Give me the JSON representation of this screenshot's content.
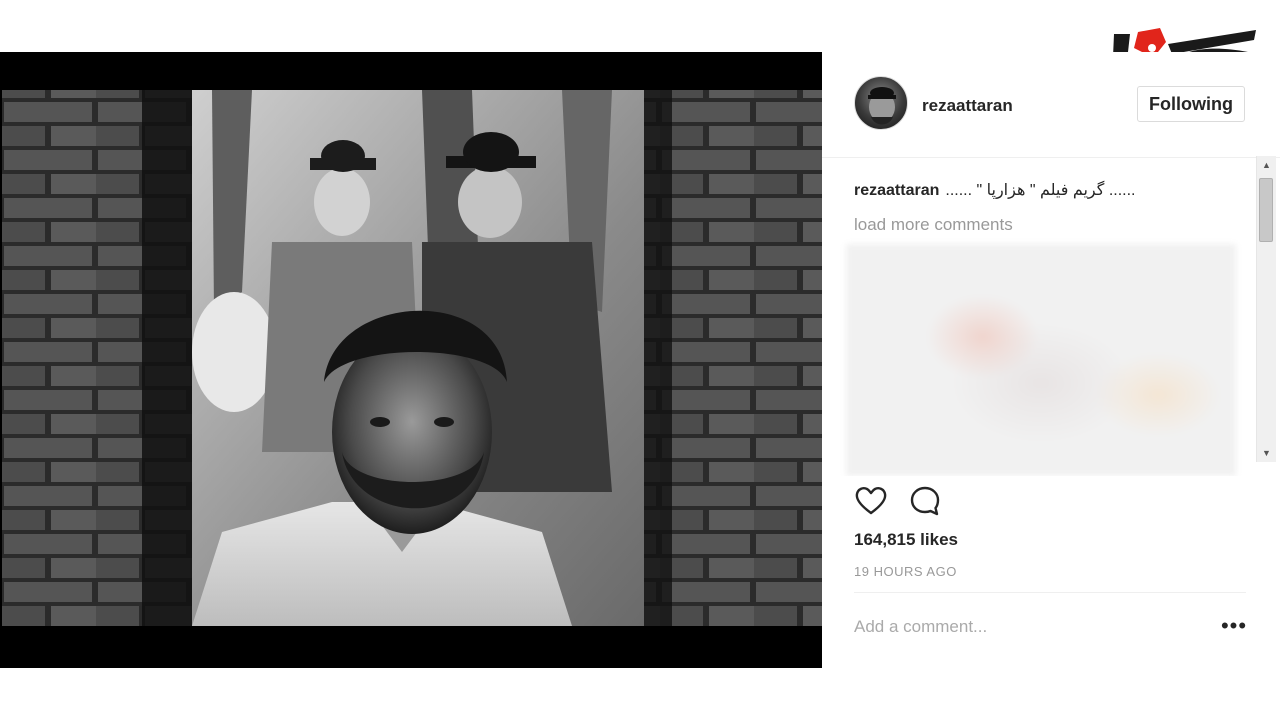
{
  "colors": {
    "accent_red": "#e1251b",
    "logo_black": "#1a1a1a",
    "panel_bg": "#ffffff",
    "photo_bg": "#000000"
  },
  "logo": {
    "icon": "rokna-logo"
  },
  "post": {
    "username": "rezaattaran",
    "follow_label": "Following",
    "caption_user": "rezaattaran",
    "caption_text": "...... \" گریم فیلم \" هزارپا ......",
    "load_more": "load more comments",
    "likes": "164,815 likes",
    "time": "19 HOURS AGO",
    "comment_placeholder": "Add a comment...",
    "more_icon": "ellipsis-icon",
    "like_icon": "heart-icon",
    "comment_icon": "comment-bubble-icon"
  }
}
